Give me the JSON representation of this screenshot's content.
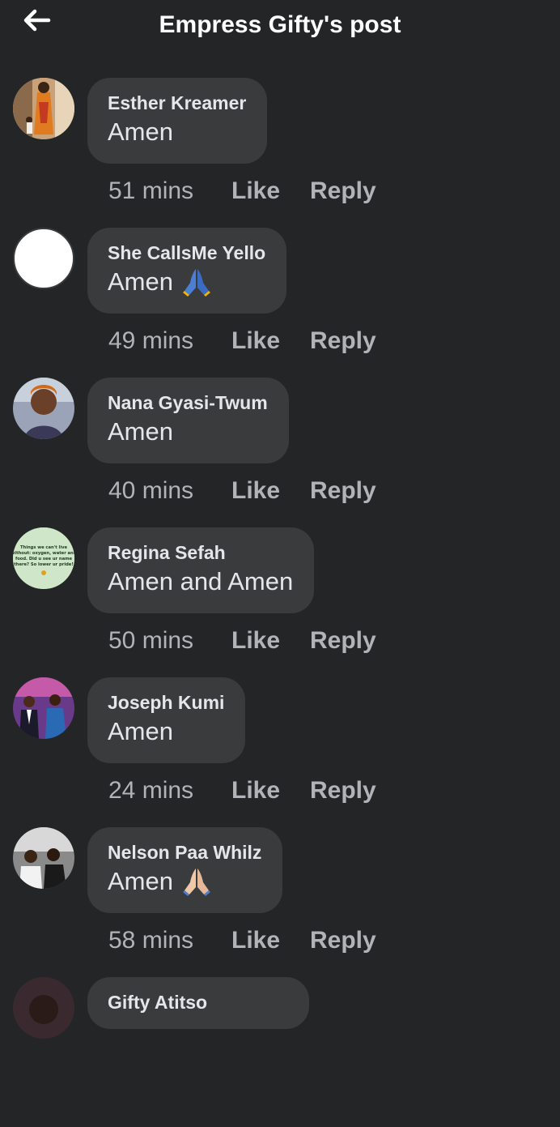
{
  "header": {
    "title": "Empress Gifty's post",
    "back_icon": "arrow-left-icon"
  },
  "comments": [
    {
      "author": "Esther Kreamer",
      "text": "Amen",
      "emoji": "",
      "time": "51 mins",
      "like": "Like",
      "reply": "Reply"
    },
    {
      "author": "She CallsMe Yello",
      "text": "Amen",
      "emoji": "praying-hands-icon",
      "time": "49 mins",
      "like": "Like",
      "reply": "Reply"
    },
    {
      "author": "Nana Gyasi-Twum",
      "text": "Amen",
      "emoji": "",
      "time": "40 mins",
      "like": "Like",
      "reply": "Reply"
    },
    {
      "author": "Regina Sefah",
      "text": "Amen and Amen",
      "emoji": "",
      "time": "50 mins",
      "like": "Like",
      "reply": "Reply",
      "avatar_text": "Things we can't live without: oxygen, water and food. Did u see ur name there? So lower ur pride!"
    },
    {
      "author": "Joseph Kumi",
      "text": "Amen",
      "emoji": "",
      "time": "24 mins",
      "like": "Like",
      "reply": "Reply"
    },
    {
      "author": "Nelson Paa Whilz",
      "text": "Amen",
      "emoji": "praying-hands-icon",
      "time": "58 mins",
      "like": "Like",
      "reply": "Reply"
    },
    {
      "author": "Gifty Atitso",
      "text": "",
      "emoji": "",
      "time": "",
      "like": "",
      "reply": ""
    }
  ],
  "colors": {
    "background": "#242526",
    "bubble": "#3a3b3c",
    "text": "#e4e6eb",
    "secondary_text": "#b0b3b8"
  }
}
